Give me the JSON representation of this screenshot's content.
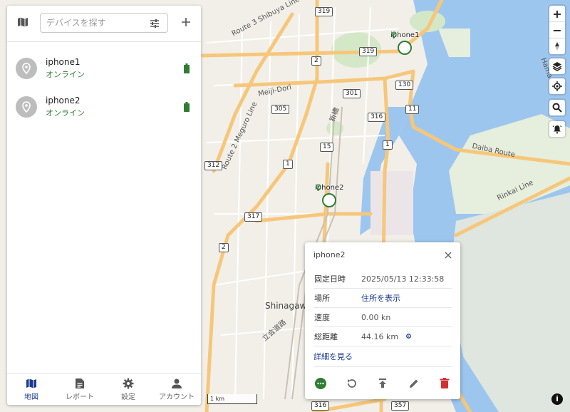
{
  "search": {
    "placeholder": "デバイスを探す"
  },
  "devices": [
    {
      "name": "iphone1",
      "status": "オンライン"
    },
    {
      "name": "iphone2",
      "status": "オンライン"
    }
  ],
  "nav": [
    {
      "label": "地図",
      "icon": "map-icon",
      "active": true
    },
    {
      "label": "レポート",
      "icon": "report-icon"
    },
    {
      "label": "設定",
      "icon": "gear-icon"
    },
    {
      "label": "アカウント",
      "icon": "person-icon"
    }
  ],
  "map": {
    "markers": [
      {
        "name": "iphone1"
      },
      {
        "name": "iphone2"
      }
    ],
    "road_labels": [
      "319",
      "2",
      "319",
      "130",
      "301",
      "305",
      "316",
      "11",
      "15",
      "1",
      "1",
      "312",
      "317",
      "2",
      "316",
      "357"
    ],
    "text_labels": [
      "Route 3 Shibuya Line",
      "Meiji-Dori",
      "Route 2 Meguro Line",
      "Daiba Route",
      "Rinkai Line",
      "Shinagawa",
      "立会道路",
      "Hama",
      "新橋"
    ],
    "scale_label": "1 km",
    "colors": {
      "water": "#9dc6ef",
      "road": "#f6c77a",
      "land": "#f2efe9",
      "status_green": "#2e7d32",
      "link_blue": "#1a3a8f"
    }
  },
  "controls": {
    "zoom_in": "+",
    "zoom_out": "−"
  },
  "popup": {
    "title": "iphone2",
    "rows": [
      {
        "key": "固定日時",
        "value": "2025/05/13 12:33:58"
      },
      {
        "key": "場所",
        "value": "住所を表示"
      },
      {
        "key": "速度",
        "value": "0.00 kn"
      },
      {
        "key": "総距離",
        "value": "44.16 km"
      }
    ],
    "more": "詳細を見る"
  }
}
